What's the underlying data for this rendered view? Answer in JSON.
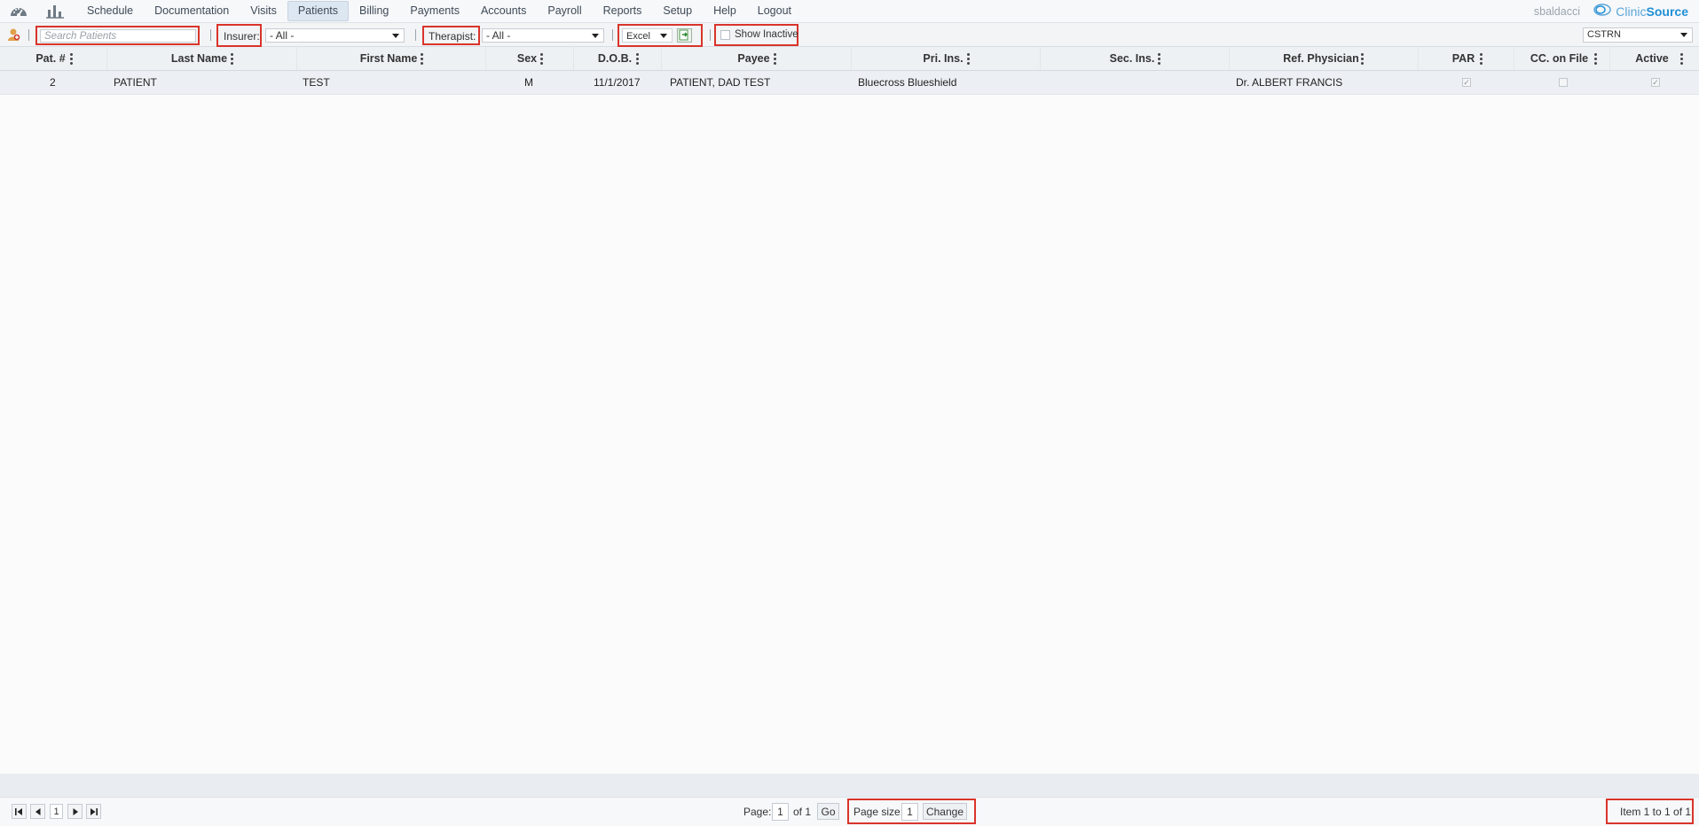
{
  "menu": {
    "items": [
      "Schedule",
      "Documentation",
      "Visits",
      "Patients",
      "Billing",
      "Payments",
      "Accounts",
      "Payroll",
      "Reports",
      "Setup",
      "Help",
      "Logout"
    ],
    "active": "Patients",
    "username": "sbaldacci",
    "brand_part1": "Clinic",
    "brand_part2": "Source"
  },
  "toolbar": {
    "search_placeholder": "Search Patients",
    "insurer_label": "Insurer:",
    "insurer_value": "- All -",
    "therapist_label": "Therapist:",
    "therapist_value": "- All -",
    "export_value": "Excel",
    "show_inactive_label": "Show Inactive",
    "show_inactive_checked": false,
    "location_value": "CSTRN"
  },
  "grid": {
    "columns": [
      "Pat. #",
      "Last Name",
      "First Name",
      "Sex",
      "D.O.B.",
      "Payee",
      "Pri. Ins.",
      "Sec. Ins.",
      "Ref. Physician",
      "PAR",
      "CC. on File",
      "Active"
    ],
    "rows": [
      {
        "pat_no": "2",
        "last_name": "PATIENT",
        "first_name": "TEST",
        "sex": "M",
        "dob": "11/1/2017",
        "payee": "PATIENT, DAD TEST",
        "pri_ins": "Bluecross Blueshield",
        "sec_ins": "",
        "ref_physician": "Dr. ALBERT FRANCIS",
        "par": true,
        "cc_on_file": false,
        "active": true
      }
    ]
  },
  "pager": {
    "current_page_button": "1",
    "page_label": "Page:",
    "page_value": "1",
    "of_label": "of 1",
    "go_label": "Go",
    "page_size_label": "Page size:",
    "page_size_value": "1",
    "change_label": "Change",
    "item_info": "Item 1 to 1 of 1"
  },
  "colors": {
    "highlight_border": "#d9342b",
    "brand_blue": "#1f8fd6",
    "active_tab_bg": "#dde7f1"
  },
  "icons": {
    "dashboard": "dashboard-gauge-icon",
    "reports": "bar-chart-icon",
    "add_patient": "add-patient-icon",
    "export": "export-excel-icon",
    "brand_logo": "clinicsource-logo-icon"
  }
}
